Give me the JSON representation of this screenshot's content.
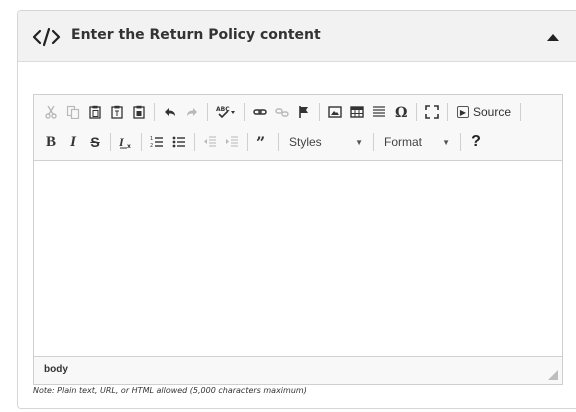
{
  "panel": {
    "title": "Enter the Return Policy content"
  },
  "toolbar": {
    "row1": [
      {
        "name": "cut-button",
        "icon": "cut-icon",
        "disabled": true
      },
      {
        "name": "copy-button",
        "icon": "copy-icon",
        "disabled": true
      },
      {
        "name": "paste-button",
        "icon": "paste-icon",
        "disabled": false
      },
      {
        "name": "paste-text-button",
        "icon": "paste-text-icon",
        "disabled": false
      },
      {
        "name": "paste-word-button",
        "icon": "paste-word-icon",
        "disabled": false
      },
      {
        "name": "undo-button",
        "icon": "undo-icon",
        "disabled": false
      },
      {
        "name": "redo-button",
        "icon": "redo-icon",
        "disabled": true
      },
      {
        "name": "spellcheck-button",
        "icon": "spellcheck-icon",
        "disabled": false
      },
      {
        "name": "link-button",
        "icon": "link-icon",
        "disabled": false
      },
      {
        "name": "unlink-button",
        "icon": "unlink-icon",
        "disabled": true
      },
      {
        "name": "anchor-button",
        "icon": "flag-icon",
        "disabled": false
      },
      {
        "name": "image-button",
        "icon": "image-icon",
        "disabled": false
      },
      {
        "name": "table-button",
        "icon": "table-icon",
        "disabled": false
      },
      {
        "name": "horizontal-line-button",
        "icon": "horizontal-line-icon",
        "disabled": false
      },
      {
        "name": "special-char-button",
        "icon": "omega-icon",
        "disabled": false
      },
      {
        "name": "maximize-button",
        "icon": "maximize-icon",
        "disabled": false
      }
    ],
    "source_label": "Source",
    "styles_label": "Styles",
    "format_label": "Format",
    "help_label": "?",
    "bold_label": "B",
    "italic_label": "I",
    "strike_label": "S"
  },
  "status": {
    "path": "body"
  },
  "note": "Note: Plain text, URL, or HTML allowed (5,000 characters maximum)"
}
